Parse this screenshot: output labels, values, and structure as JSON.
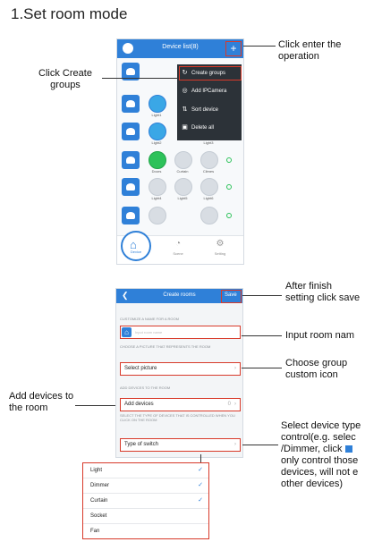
{
  "title": "1.Set room mode",
  "phone1": {
    "header_title": "Device list(8)",
    "menu": [
      {
        "icon": "group-icon",
        "glyph": "↻",
        "label": "Create groups"
      },
      {
        "icon": "camera-icon",
        "glyph": "◎",
        "label": "Add IPCamera"
      },
      {
        "icon": "sort-icon",
        "glyph": "⇅",
        "label": "Sort device"
      },
      {
        "icon": "trash-icon",
        "glyph": "▣",
        "label": "Delete all"
      }
    ],
    "device_labels": [
      "Light1",
      "Light2",
      "Light3",
      "Doors",
      "Curtain",
      "Climes",
      "Light4",
      "Light5",
      "Light6"
    ],
    "tabs": [
      "Device",
      "Scene",
      "Setting"
    ]
  },
  "phone2": {
    "back": "❮",
    "header_title": "Create rooms",
    "save": "Save",
    "sec_name": "CUSTOMIZE A NAME FOR A ROOM",
    "name_placeholder": "Input room name",
    "sec_picture": "CHOOSE A PICTURE THAT REPRESENTS THE ROOM",
    "select_picture": "Select picture",
    "sec_devices": "ADD DEVICES TO THE ROOM",
    "add_devices": "Add devices",
    "add_devices_count": "0",
    "sec_type": "SELECT THE TYPE OF DEVICES THAT IS CONTROLLED WHEN YOU CLICK ON THE ROOM",
    "type_of_switch": "Type of switch"
  },
  "switch_types": [
    {
      "label": "Light",
      "checked": true
    },
    {
      "label": "Dimmer",
      "checked": true
    },
    {
      "label": "Curtain",
      "checked": true
    },
    {
      "label": "Socket",
      "checked": false
    },
    {
      "label": "Fan",
      "checked": false
    }
  ],
  "callouts": {
    "click_plus": "Click enter the operation",
    "create_groups": "Click Create groups",
    "after_finish": "After finish setting click save",
    "input_room": "Input room nam",
    "choose_group": "Choose group custom icon",
    "add_devices": "Add devices to the room",
    "select_type": [
      "Select device type",
      "control(e.g. selec",
      "/Dimmer, click",
      "only control those",
      "devices, will not e",
      "other devices)"
    ]
  },
  "colors": {
    "accent": "#2f80d8",
    "highlight": "#d83a2a",
    "on_green": "#2dc25a"
  }
}
